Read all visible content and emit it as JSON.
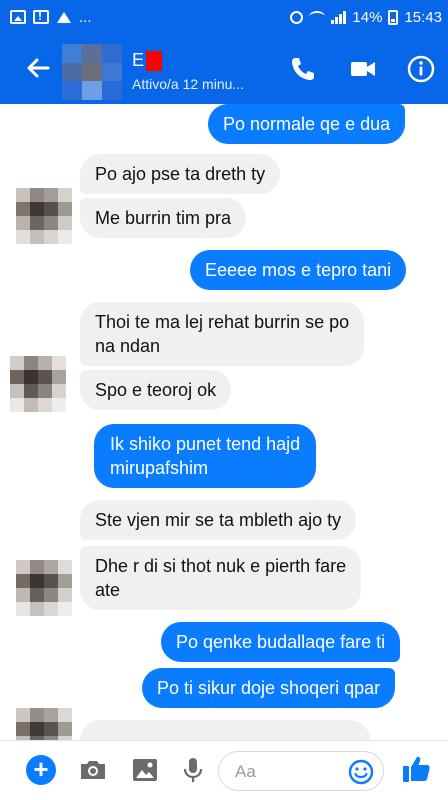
{
  "status_bar": {
    "left_icons": [
      "image-icon",
      "alert-icon",
      "cut-icon"
    ],
    "left_more": "...",
    "battery_percent": "14%",
    "time": "15:43"
  },
  "header": {
    "contact_initial": "E",
    "status_text": "Attivo/a 12 minu...",
    "icons": [
      "back-arrow-icon",
      "phone-icon",
      "video-camera-icon",
      "info-icon"
    ]
  },
  "messages": [
    {
      "direction": "out",
      "text": "Po normale qe e dua"
    },
    {
      "direction": "in",
      "text": "Po ajo pse ta dreth ty"
    },
    {
      "direction": "in",
      "text": "Me burrin tim pra"
    },
    {
      "direction": "out",
      "text": "Eeeee mos e tepro tani"
    },
    {
      "direction": "in",
      "text_lines": [
        "Thoi te ma lej rehat burrin se po",
        "na ndan"
      ]
    },
    {
      "direction": "in",
      "text": "Spo e teoroj ok"
    },
    {
      "direction": "out",
      "text_lines": [
        "Ik shiko punet tend hajd",
        "mirupafshim"
      ]
    },
    {
      "direction": "in",
      "text": "Ste vjen mir se ta mbleth ajo ty"
    },
    {
      "direction": "in",
      "text_lines": [
        "Dhe r di si thot nuk e pierth fare",
        "ate"
      ]
    },
    {
      "direction": "out",
      "text": "Po qenke budallaqe fare ti"
    },
    {
      "direction": "out",
      "text": "Po ti sikur doje shoqeri qpar"
    }
  ],
  "composer": {
    "placeholder": "Aa",
    "icons": [
      "plus-icon",
      "camera-icon",
      "gallery-icon",
      "microphone-icon",
      "emoji-icon",
      "like-icon"
    ]
  },
  "colors": {
    "brand_blue": "#0866e8",
    "outgoing_bubble": "#0a7cff",
    "incoming_bubble": "#f0f0f0"
  }
}
